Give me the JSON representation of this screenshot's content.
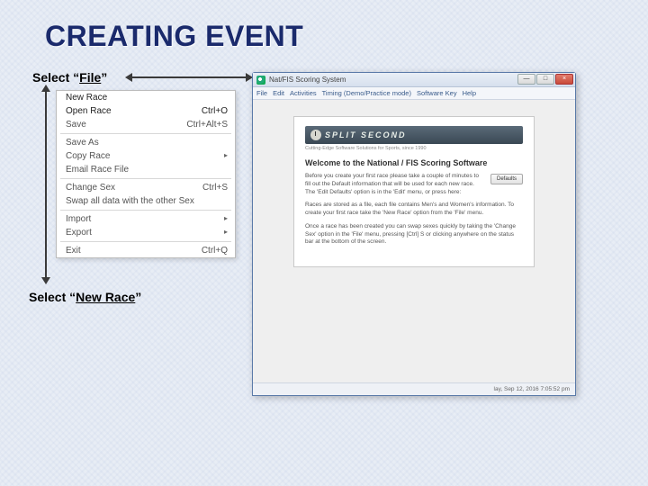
{
  "title": "CREATING EVENT",
  "instructions": {
    "file_prefix": "Select ",
    "file_quoted": "“",
    "file_word": "File",
    "file_end": "”",
    "newrace_prefix": "Select ",
    "newrace_q1": "“",
    "newrace_word": "New Race",
    "newrace_q2": "”"
  },
  "menu": {
    "items": [
      {
        "label": "New Race",
        "shortcut": ""
      },
      {
        "label": "Open Race",
        "shortcut": "Ctrl+O"
      },
      {
        "label": "Save",
        "shortcut": "Ctrl+Alt+S"
      }
    ],
    "group2": [
      {
        "label": "Save As",
        "shortcut": ""
      },
      {
        "label": "Copy Race",
        "shortcut": "",
        "sub": true
      },
      {
        "label": "Email Race File",
        "shortcut": ""
      }
    ],
    "group3": [
      {
        "label": "Change Sex",
        "shortcut": "Ctrl+S"
      },
      {
        "label": "Swap all data with the other Sex",
        "shortcut": ""
      }
    ],
    "group4": [
      {
        "label": "Import",
        "shortcut": "",
        "sub": true
      },
      {
        "label": "Export",
        "shortcut": "",
        "sub": true
      }
    ],
    "group5": [
      {
        "label": "Exit",
        "shortcut": "Ctrl+Q"
      }
    ]
  },
  "app": {
    "title": "Nat/FIS Scoring System",
    "winmin": "—",
    "winmax": "□",
    "winclose": "×",
    "menubar": [
      "File",
      "Edit",
      "Activities",
      "Timing (Demo/Practice mode)",
      "Software Key",
      "Help"
    ],
    "brand": "SPLIT SECOND",
    "brand_sub": "Cutting-Edge Software Solutions for Sports, since 1990",
    "panel_heading": "Welcome to the National / FIS Scoring Software",
    "para1": "Before you create your first race please take a couple of minutes to fill out the Default information that will be used for each new race. The 'Edit Defaults' option is in the 'Edit' menu, or press here:",
    "defaults_btn": "Defaults",
    "para2": "Races are stored as a file, each file contains Men's and Women's information. To create your first race take the 'New Race' option from the 'File' menu.",
    "para3": "Once a race has been created you can swap sexes quickly by taking the 'Change Sex' option in the 'File' menu, pressing [Ctrl] S or clicking anywhere on the status bar at the bottom of the screen.",
    "status": "lay, Sep 12, 2016  7:05:52 pm"
  }
}
